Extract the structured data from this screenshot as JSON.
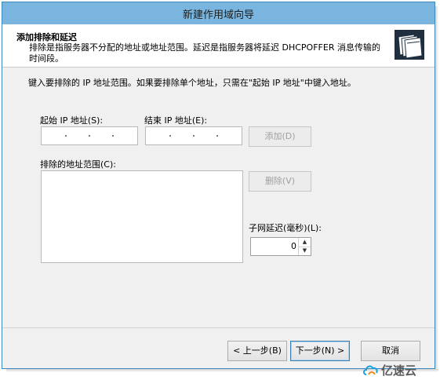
{
  "window": {
    "title": "新建作用域向导"
  },
  "header": {
    "title": "添加排除和延迟",
    "description": "排除是指服务器不分配的地址或地址范围。延迟是指服务器将延迟 DHCPOFFER 消息传输的时间段。",
    "icon": "folders-icon"
  },
  "instruction": "键入要排除的 IP 地址范围。如果要排除单个地址，只需在\"起始 IP 地址\"中键入地址。",
  "start_ip": {
    "label": "起始 IP 地址(S):",
    "value": ""
  },
  "end_ip": {
    "label": "结束 IP 地址(E):",
    "value": ""
  },
  "add_button": "添加(D)",
  "excluded_range": {
    "label": "排除的地址范围(C):",
    "items": []
  },
  "remove_button": "删除(V)",
  "subnet_delay": {
    "label": "子网延迟(毫秒)(L):",
    "value": "0"
  },
  "footer": {
    "back": "< 上一步(B)",
    "next": "下一步(N) >",
    "cancel": "取消"
  },
  "watermark": {
    "text": "亿速云",
    "icon": "cloud-logo-icon"
  }
}
